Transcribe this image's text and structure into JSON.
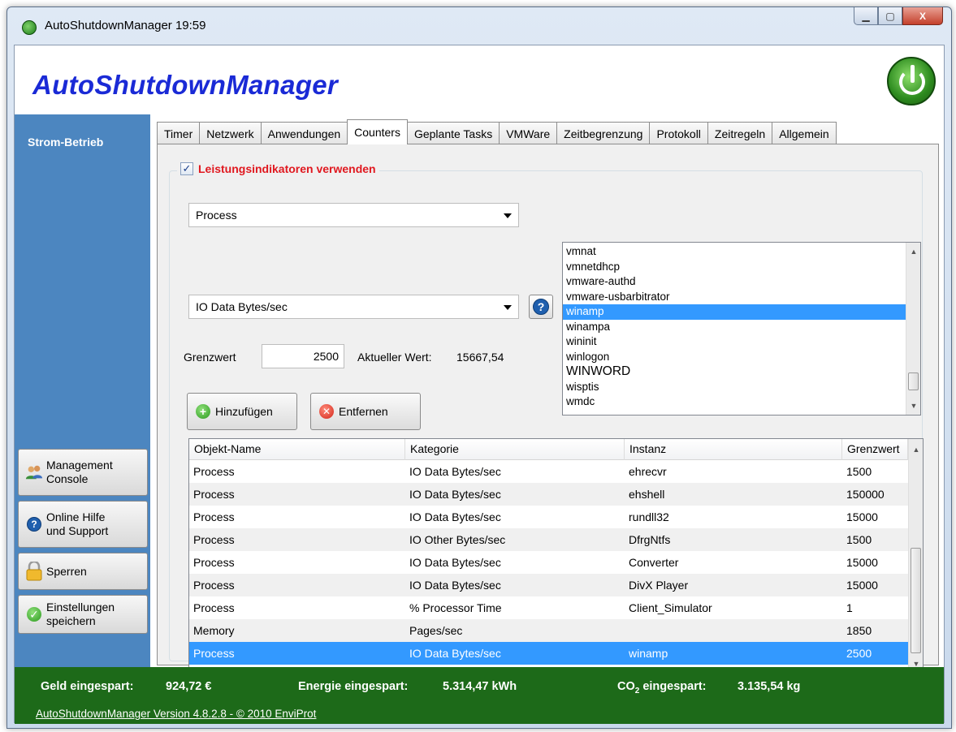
{
  "window": {
    "title": "AutoShutdownManager 19:59",
    "controls": {
      "minimize": "▁",
      "maximize": "▢",
      "close": "X"
    }
  },
  "header": {
    "brand": "AutoShutdownManager",
    "logo_icon": "power-logo-icon"
  },
  "sidebar": {
    "title": "Strom-Betrieb",
    "buttons": [
      {
        "label_line1": "Management",
        "label_line2": "Console",
        "icon": "users-icon"
      },
      {
        "label_line1": "Online Hilfe",
        "label_line2": "und Support",
        "icon": "help-icon"
      },
      {
        "label_line1": "Sperren",
        "label_line2": "",
        "icon": "lock-icon"
      },
      {
        "label_line1": "Einstellungen",
        "label_line2": "speichern",
        "icon": "checkmark-icon"
      }
    ]
  },
  "tabs": [
    "Timer",
    "Netzwerk",
    "Anwendungen",
    "Counters",
    "Geplante Tasks",
    "VMWare",
    "Zeitbegrenzung",
    "Protokoll",
    "Zeitregeln",
    "Allgemein"
  ],
  "active_tab": "Counters",
  "counters": {
    "group_checkbox_checked": true,
    "group_title": "Leistungsindikatoren verwenden",
    "object_combo": "Process",
    "counter_combo": "IO Data Bytes/sec",
    "threshold_label": "Grenzwert",
    "threshold_value": "2500",
    "current_label": "Aktueller Wert:",
    "current_value": "15667,54",
    "add_button": "Hinzufügen",
    "remove_button": "Entfernen",
    "help_button": "?",
    "instances": [
      "vmnat",
      "vmnetdhcp",
      "vmware-authd",
      "vmware-usbarbitrator",
      "winamp",
      "winampa",
      "wininit",
      "winlogon",
      "WINWORD",
      "wisptis",
      "wmdc"
    ],
    "selected_instance": "winamp",
    "grid_columns": [
      "Objekt-Name",
      "Kategorie",
      "Instanz",
      "Grenzwert"
    ],
    "grid_rows": [
      [
        "Process",
        "IO Data Bytes/sec",
        "ehrecvr",
        "1500"
      ],
      [
        "Process",
        "IO Data Bytes/sec",
        "ehshell",
        "150000"
      ],
      [
        "Process",
        "IO Data Bytes/sec",
        "rundll32",
        "15000"
      ],
      [
        "Process",
        "IO Other Bytes/sec",
        "DfrgNtfs",
        "1500"
      ],
      [
        "Process",
        "IO Data Bytes/sec",
        "Converter",
        "15000"
      ],
      [
        "Process",
        "IO Data Bytes/sec",
        "DivX Player",
        "15000"
      ],
      [
        "Process",
        "% Processor Time",
        "Client_Simulator",
        "1"
      ],
      [
        "Memory",
        "Pages/sec",
        "",
        "1850"
      ],
      [
        "Process",
        "IO Data Bytes/sec",
        "winamp",
        "2500"
      ]
    ],
    "selected_row": 8
  },
  "footer": {
    "money_label": "Geld eingespart:",
    "money_value": "924,72 €",
    "energy_label": "Energie eingespart:",
    "energy_value": "5.314,47 kWh",
    "co2_label_prefix": "CO",
    "co2_label_sub": "2",
    "co2_label_suffix": " eingespart:",
    "co2_value": "3.135,54 kg",
    "version": "AutoShutdownManager Version 4.8.2.8  - © 2010 EnviProt",
    "bg_color": "#1d6a19"
  },
  "colors": {
    "brand": "#1a2ad6",
    "sidebar": "#4c86c0",
    "selection": "#3399ff",
    "group_title": "#e0181f"
  }
}
